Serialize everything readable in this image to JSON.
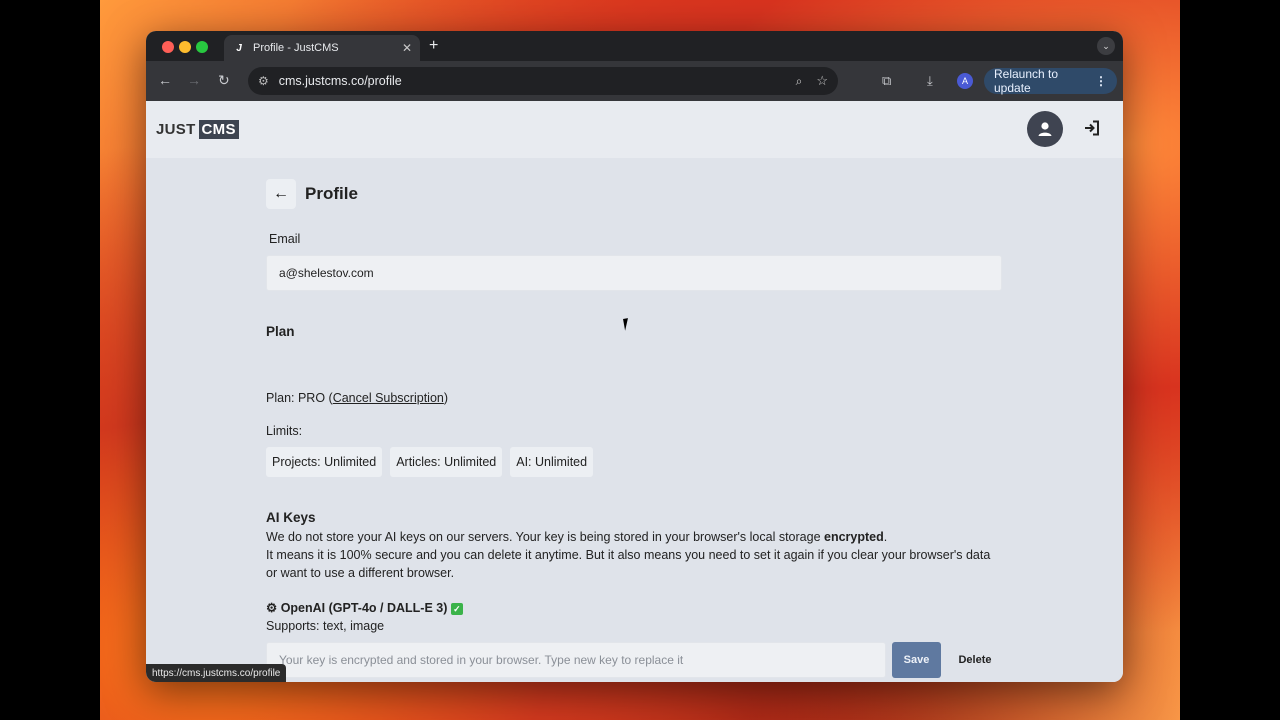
{
  "browser": {
    "tab_title": "Profile - JustCMS",
    "favicon": "J",
    "url": "cms.justcms.co/profile",
    "relaunch_label": "Relaunch to update",
    "avatar_letter": "A",
    "status_url": "https://cms.justcms.co/profile"
  },
  "app": {
    "logo_just": "JUST",
    "logo_cms": "CMS"
  },
  "page": {
    "title": "Profile",
    "email_label": "Email",
    "email_value": "a@shelestov.com",
    "plan": {
      "heading": "Plan",
      "plan_prefix": "Plan: PRO (",
      "cancel_link": "Cancel Subscription",
      "plan_suffix": ")",
      "limits_label": "Limits:",
      "limits": [
        "Projects: Unlimited",
        "Articles: Unlimited",
        "AI: Unlimited"
      ]
    },
    "ai_keys": {
      "heading": "AI Keys",
      "desc_line1_a": "We do not store your AI keys on our servers. Your key is being stored in your browser's local storage ",
      "desc_line1_bold": "encrypted",
      "desc_line1_b": ".",
      "desc_line2": "It means it is 100% secure and you can delete it anytime. But it also means you need to set it again if you clear your browser's data or want to use a different browser.",
      "provider_name": "OpenAI (GPT-4o / DALL-E 3)",
      "provider_check": "✓",
      "supports": "Supports: text, image",
      "key_placeholder": "Your key is encrypted and stored in your browser. Type new key to replace it",
      "save_label": "Save",
      "delete_label": "Delete"
    }
  },
  "colors": {
    "save_button": "#5f79a0",
    "relaunch_button": "#2f4a69",
    "page_bg": "#dfe3ea"
  }
}
